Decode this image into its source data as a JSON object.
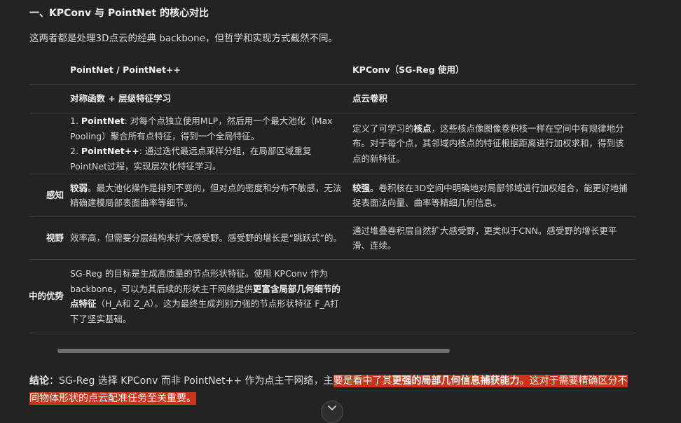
{
  "heading": "一、KPConv 与 PointNet 的核心对比",
  "intro": "这两者都是处理3D点云的经典 backbone，但哲学和实现方式截然不同。",
  "table": {
    "headers": [
      "",
      "PointNet / PointNet++",
      "KPConv（SG-Reg 使用）"
    ],
    "core": {
      "label": "",
      "pointnet": "对称函数 + 层级特征学习",
      "kpconv": "点云卷积"
    },
    "impl": {
      "label": "",
      "pn_1_b": "PointNet",
      "pn_1": ": 对每个点独立使用MLP，然后用一个最大池化（Max Pooling）聚合所有点特征，得到一个全局特征。",
      "pn_2_b": "PointNet++",
      "pn_2": ": 通过迭代最远点采样分组，在局部区域重复PointNet过程，实现层次化特征学习。",
      "kp_a": "定义了可学习的",
      "kp_b": "核点",
      "kp_c": "，这些核点像图像卷积核一样在空间中有规律地分布。对于每个点，其邻域内核点的特征根据距离进行加权求和，得到该点的新特征。"
    },
    "local": {
      "label": "感知",
      "pn_b": "较弱",
      "pn": "。最大池化操作是排列不变的，但对点的密度和分布不敏感，无法精确建模局部表面曲率等细节。",
      "kp_b": "较强",
      "kp": "。卷积核在3D空间中明确地对局部邻域进行加权组合，能更好地捕捉表面法向量、曲率等精细几何信息。"
    },
    "rf": {
      "label": "视野",
      "pn": "效率高，但需要分层结构来扩大感受野。感受野的增长是“跳跃式”的。",
      "kp": "通过堆叠卷积层自然扩大感受野，更类似于CNN。感受野的增长更平滑、连续。"
    },
    "adv": {
      "label": "中的优势",
      "pn_a": "SG-Reg 的目标是生成高质量的节点形状特征。使用 KPConv 作为 backbone，可以为其后续的形状主干网络提供",
      "pn_b": "更富含局部几何细节的点特征",
      "pn_c": "（H_A和 Z_A）。这为最终生成判别力强的节点形状特征 F_A打下了坚实基础。",
      "kp": ""
    }
  },
  "conclusion": {
    "label": "结论",
    "text_a": "：SG-Reg 选择 KPConv 而非 PointNet++ 作为点主干网络，主",
    "hl_a": "要是看中了其",
    "hl_b": "更强的局部几何信息捕获能力",
    "hl_c": "。这对于需要精确区分不同物体形状的点云配准任务至关重要。"
  },
  "icons": {
    "scroll_down": "chevron-down-icon"
  },
  "colors": {
    "background": "#232323",
    "highlight": "#c8351b"
  }
}
